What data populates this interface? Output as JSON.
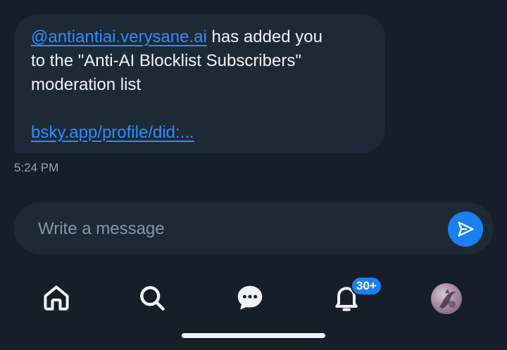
{
  "message": {
    "mention": "@antiantiai.verysane.ai",
    "line1_rest": " has added you",
    "line2": "to the \"Anti-AI Blocklist Subscribers\"",
    "line3": "moderation list",
    "link": "bsky.app/profile/did:...",
    "timestamp": "5:24 PM"
  },
  "composer": {
    "placeholder": "Write a message",
    "send_icon": "send-icon"
  },
  "nav": {
    "items": [
      {
        "name": "home",
        "icon": "home-icon"
      },
      {
        "name": "search",
        "icon": "search-icon"
      },
      {
        "name": "chat",
        "icon": "chat-icon"
      },
      {
        "name": "notifications",
        "icon": "bell-icon"
      },
      {
        "name": "profile",
        "icon": "avatar"
      }
    ],
    "notification_badge": "30+"
  },
  "colors": {
    "background": "#161e27",
    "bubble": "#1e2936",
    "link": "#2a8eff",
    "accent": "#1a7ff0",
    "text": "#f1f3f5",
    "muted": "#93a4b6"
  }
}
